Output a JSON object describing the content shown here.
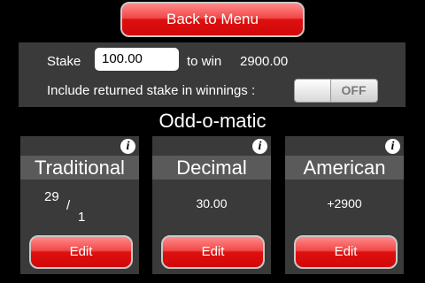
{
  "header": {
    "back_label": "Back to Menu"
  },
  "stake": {
    "stake_label": "Stake",
    "stake_value": "100.00",
    "to_win_label": "to win",
    "to_win_value": "2900.00",
    "include_label": "Include returned stake in winnings :",
    "toggle_state": "OFF"
  },
  "app_title": "Odd-o-matic",
  "cards": [
    {
      "title": "Traditional",
      "numerator": "29",
      "slash": "/",
      "denominator": "1",
      "edit_label": "Edit"
    },
    {
      "title": "Decimal",
      "value": "30.00",
      "edit_label": "Edit"
    },
    {
      "title": "American",
      "value": "+2900",
      "edit_label": "Edit"
    }
  ],
  "info_glyph": "i",
  "colors": {
    "accent_red": "#e21a1a",
    "panel": "#3a3a3a",
    "header_bar": "#5a5a5a"
  }
}
